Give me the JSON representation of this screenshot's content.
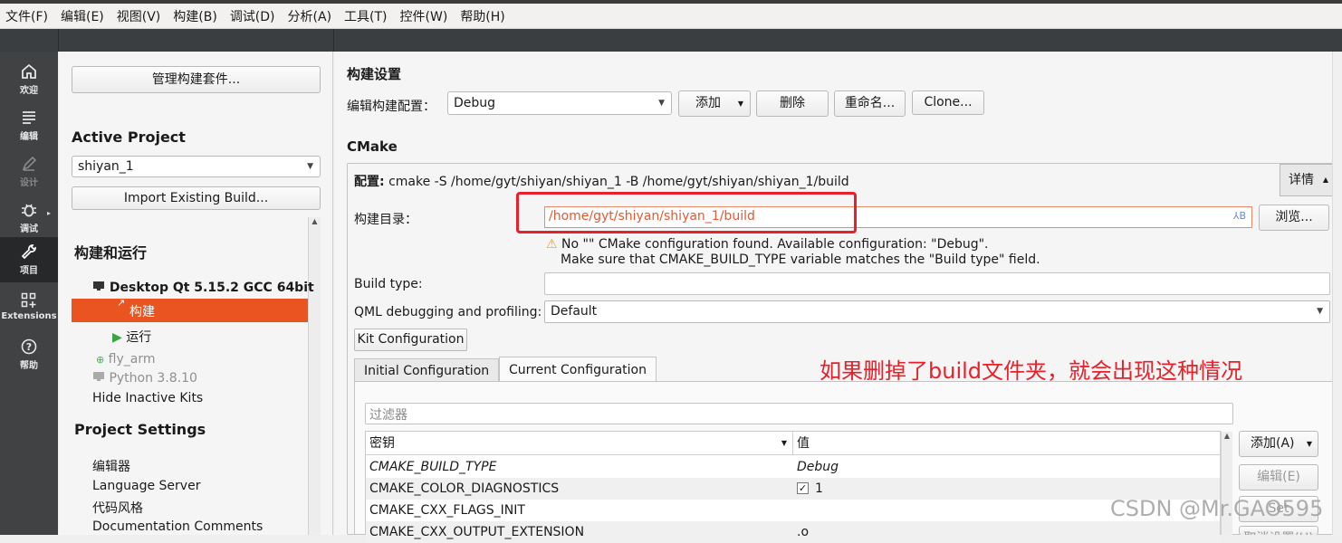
{
  "menubar": [
    "文件(F)",
    "编辑(E)",
    "视图(V)",
    "构建(B)",
    "调试(D)",
    "分析(A)",
    "工具(T)",
    "控件(W)",
    "帮助(H)"
  ],
  "modes": [
    {
      "label": "欢迎",
      "icon": "home-icon"
    },
    {
      "label": "编辑",
      "icon": "edit-icon"
    },
    {
      "label": "设计",
      "icon": "design-icon"
    },
    {
      "label": "调试",
      "icon": "debug-bug-icon"
    },
    {
      "label": "项目",
      "icon": "wrench-icon"
    },
    {
      "label": "Extensions",
      "icon": "extensions-icon"
    },
    {
      "label": "帮助",
      "icon": "help-icon"
    }
  ],
  "sidebar": {
    "manage_kits": "管理构建套件...",
    "active_project_title": "Active Project",
    "active_project": "shiyan_1",
    "import_build": "Import Existing Build...",
    "build_run_title": "构建和运行",
    "kit_name": "Desktop Qt 5.15.2 GCC 64bit",
    "build_item": "构建",
    "run_item": "运行",
    "inactive_kit_1": "fly_arm",
    "inactive_kit_2": "Python 3.8.10",
    "hide_inactive": "Hide Inactive Kits",
    "project_settings_title": "Project Settings",
    "settings_items": [
      "编辑器",
      "Language Server",
      "代码风格",
      "Documentation Comments"
    ]
  },
  "build_settings": {
    "title": "构建设置",
    "edit_config_label": "编辑构建配置：",
    "config_value": "Debug",
    "add": "添加",
    "remove": "删除",
    "rename": "重命名...",
    "clone": "Clone..."
  },
  "cmake": {
    "title": "CMake",
    "config_prefix": "配置:",
    "config_cmd": "cmake -S /home/gyt/shiyan/shiyan_1 -B /home/gyt/shiyan/shiyan_1/build",
    "details": "详情",
    "build_dir_label": "构建目录：",
    "build_dir_value": "/home/gyt/shiyan/shiyan_1/build",
    "browse": "浏览...",
    "warning_line1": "No \"\" CMake configuration found. Available configuration: \"Debug\".",
    "warning_line2": "Make sure that CMAKE_BUILD_TYPE variable matches the \"Build type\" field.",
    "build_type_label": "Build type:",
    "build_type_value": "",
    "qml_label": "QML debugging and profiling:",
    "qml_value": "Default",
    "kit_config": "Kit Configuration",
    "tab_initial": "Initial Configuration",
    "tab_current": "Current Configuration",
    "filter_placeholder": "过滤器",
    "col_key": "密钥",
    "col_value": "值",
    "rows": [
      {
        "key": "CMAKE_BUILD_TYPE",
        "value": "Debug"
      },
      {
        "key": "CMAKE_COLOR_DIAGNOSTICS",
        "value": "1"
      },
      {
        "key": "CMAKE_CXX_FLAGS_INIT",
        "value": ""
      },
      {
        "key": "CMAKE_CXX_OUTPUT_EXTENSION",
        "value": ".o"
      }
    ],
    "side_add": "添加(A)",
    "side_edit": "编辑(E)",
    "side_set": "Set",
    "side_unset": "取消设置(U)"
  },
  "annotation": "如果删掉了build文件夹，就会出现这种情况",
  "watermark": "CSDN @Mr.GAO595",
  "colors": {
    "accent": "#e95420",
    "annotation": "#e8202a",
    "warning": "#f0a30a"
  }
}
